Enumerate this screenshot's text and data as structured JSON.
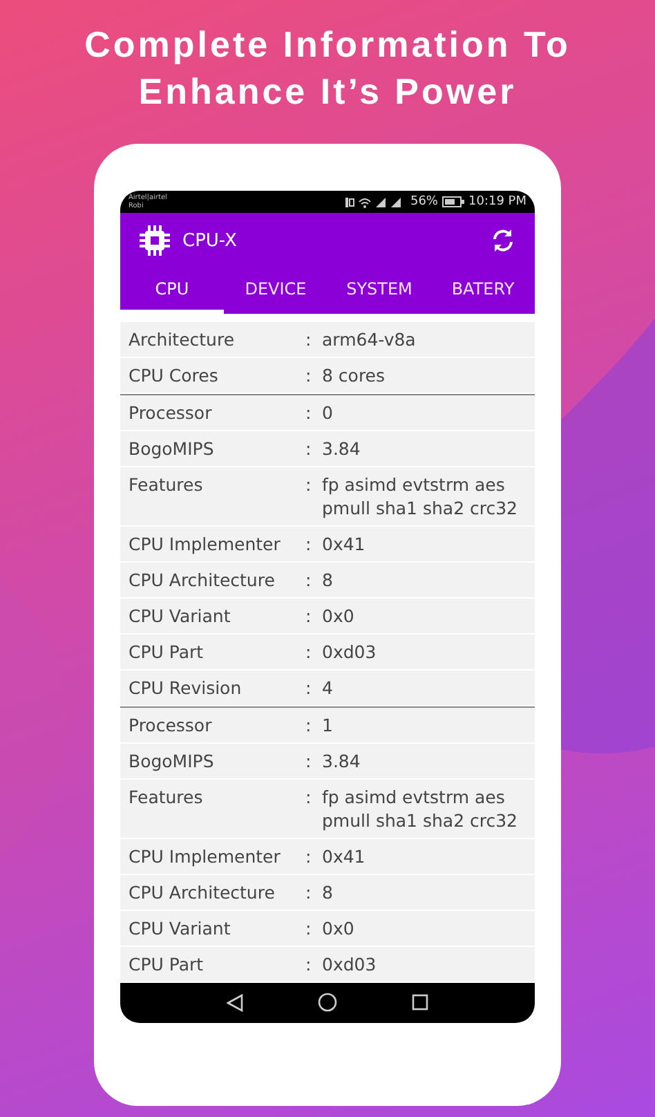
{
  "headline": [
    "Complete Information To",
    "Enhance It’s Power"
  ],
  "status_bar": {
    "carrier": "Airtel|airtel",
    "carrier_2": "Robi",
    "battery": "56%",
    "time": "10:19 PM"
  },
  "app_bar": {
    "title": "CPU-X"
  },
  "tabs": [
    {
      "label": "CPU",
      "selected": true
    },
    {
      "label": "DEVICE",
      "selected": false
    },
    {
      "label": "SYSTEM",
      "selected": false
    },
    {
      "label": "BATERY",
      "selected": false
    }
  ],
  "groups": [
    {
      "rows": [
        {
          "label": "Architecture",
          "colon": ":",
          "value": "arm64-v8a"
        },
        {
          "label": "CPU Cores",
          "colon": ":",
          "value": "8 cores"
        }
      ]
    },
    {
      "rows": [
        {
          "label": "Processor",
          "colon": ":",
          "value": "0"
        },
        {
          "label": "BogoMIPS",
          "colon": ":",
          "value": "3.84"
        },
        {
          "label": "Features",
          "colon": ":",
          "value": "fp asimd evtstrm aes pmull sha1 sha2 crc32"
        },
        {
          "label": "CPU Implementer",
          "colon": ":",
          "value": "0x41"
        },
        {
          "label": "CPU Architecture",
          "colon": ":",
          "value": "8"
        },
        {
          "label": "CPU Variant",
          "colon": ":",
          "value": "0x0"
        },
        {
          "label": "CPU Part",
          "colon": ":",
          "value": "0xd03"
        },
        {
          "label": "CPU Revision",
          "colon": ":",
          "value": "4"
        }
      ]
    },
    {
      "rows": [
        {
          "label": "Processor",
          "colon": ":",
          "value": "1"
        },
        {
          "label": "BogoMIPS",
          "colon": ":",
          "value": "3.84"
        },
        {
          "label": "Features",
          "colon": ":",
          "value": "fp asimd evtstrm aes pmull sha1 sha2 crc32"
        },
        {
          "label": "CPU Implementer",
          "colon": ":",
          "value": "0x41"
        },
        {
          "label": "CPU Architecture",
          "colon": ":",
          "value": "8"
        },
        {
          "label": "CPU Variant",
          "colon": ":",
          "value": "0x0"
        },
        {
          "label": "CPU Part",
          "colon": ":",
          "value": "0xd03"
        }
      ]
    }
  ]
}
